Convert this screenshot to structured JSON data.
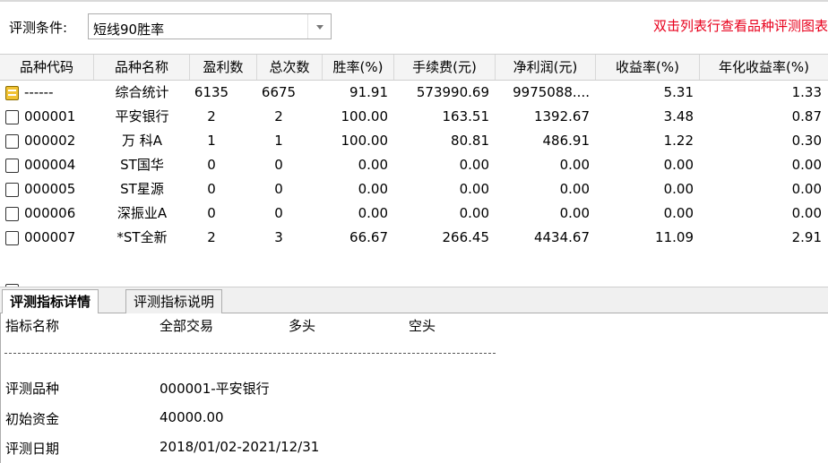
{
  "condition": {
    "label": "评测条件:",
    "selected": "短线90胜率",
    "hint": "双击列表行查看品种评测图表"
  },
  "table": {
    "columns": [
      "品种代码",
      "品种名称",
      "盈利数",
      "总次数",
      "胜率(%)",
      "手续费(元)",
      "净利润(元)",
      "收益率(%)",
      "年化收益率(%)"
    ],
    "rows": [
      {
        "code": "------",
        "name": "综合统计",
        "wins": "6135",
        "total": "6675",
        "winrate": "91.91",
        "fee": "573990.69",
        "profit": "9975088....",
        "ret": "5.31",
        "annual": "1.33",
        "icon": "summary-icon"
      },
      {
        "code": "000001",
        "name": "平安银行",
        "wins": "2",
        "total": "2",
        "winrate": "100.00",
        "fee": "163.51",
        "profit": "1392.67",
        "ret": "3.48",
        "annual": "0.87",
        "icon": "document-icon"
      },
      {
        "code": "000002",
        "name": "万 科A",
        "wins": "1",
        "total": "1",
        "winrate": "100.00",
        "fee": "80.81",
        "profit": "486.91",
        "ret": "1.22",
        "annual": "0.30",
        "icon": "document-icon"
      },
      {
        "code": "000004",
        "name": "ST国华",
        "wins": "0",
        "total": "0",
        "winrate": "0.00",
        "fee": "0.00",
        "profit": "0.00",
        "ret": "0.00",
        "annual": "0.00",
        "icon": "document-icon"
      },
      {
        "code": "000005",
        "name": "ST星源",
        "wins": "0",
        "total": "0",
        "winrate": "0.00",
        "fee": "0.00",
        "profit": "0.00",
        "ret": "0.00",
        "annual": "0.00",
        "icon": "document-icon"
      },
      {
        "code": "000006",
        "name": "深振业A",
        "wins": "0",
        "total": "0",
        "winrate": "0.00",
        "fee": "0.00",
        "profit": "0.00",
        "ret": "0.00",
        "annual": "0.00",
        "icon": "document-icon"
      },
      {
        "code": "000007",
        "name": "*ST全新",
        "wins": "2",
        "total": "3",
        "winrate": "66.67",
        "fee": "266.45",
        "profit": "4434.67",
        "ret": "11.09",
        "annual": "2.91",
        "icon": "document-icon"
      }
    ]
  },
  "tabs": [
    {
      "label": "评测指标详情",
      "active": true
    },
    {
      "label": "评测指标说明",
      "active": false
    }
  ],
  "detail": {
    "header": {
      "name": "指标名称",
      "all": "全部交易",
      "long": "多头",
      "short": "空头"
    },
    "items": [
      {
        "label": "评测品种",
        "value": "000001-平安银行"
      },
      {
        "label": "初始资金",
        "value": "40000.00"
      },
      {
        "label": "评测日期",
        "value": "2018/01/02-2021/12/31"
      }
    ]
  }
}
